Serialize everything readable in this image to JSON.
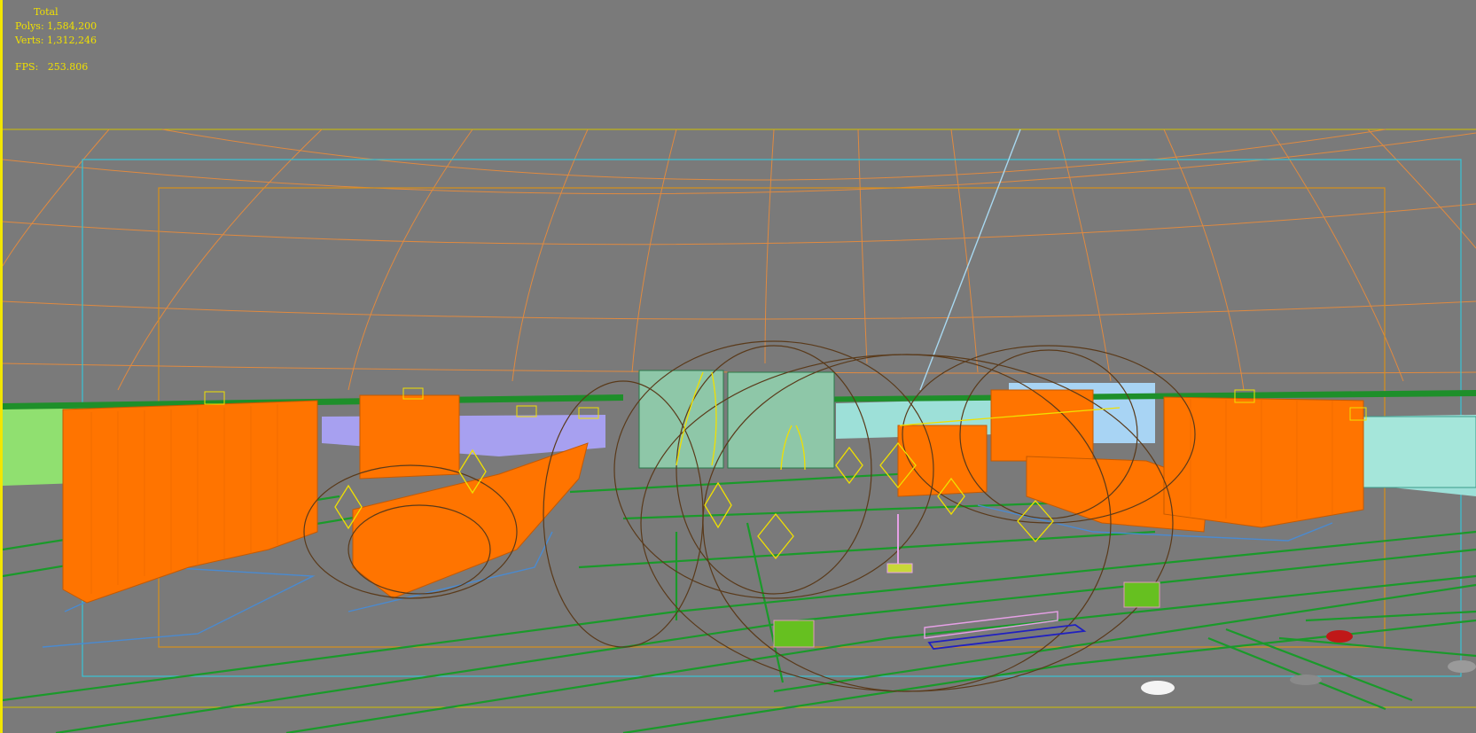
{
  "viewport": {
    "stats": {
      "header": "Total",
      "polys_label": "Polys:",
      "polys_value": "1,584,200",
      "verts_label": "Verts:",
      "verts_value": "1,312,246",
      "fps_label": "FPS:",
      "fps_value": "253.806"
    },
    "colors": {
      "background": "#7a7a7a",
      "stats_text": "#f0e000",
      "buildings": "#ff7400",
      "grid_dome": "#e08a40",
      "roads": "#1a9a2a",
      "safe_frame_outer": "#37c4d6",
      "safe_frame_inner": "#d8901a",
      "cyan_buildings": "#9de0d8",
      "blue_ground": "#a7a0f0"
    },
    "objects": [
      "environment-dome-icon",
      "building-icon",
      "light-gizmo-icon",
      "camera-icon",
      "vehicle-icon"
    ]
  }
}
